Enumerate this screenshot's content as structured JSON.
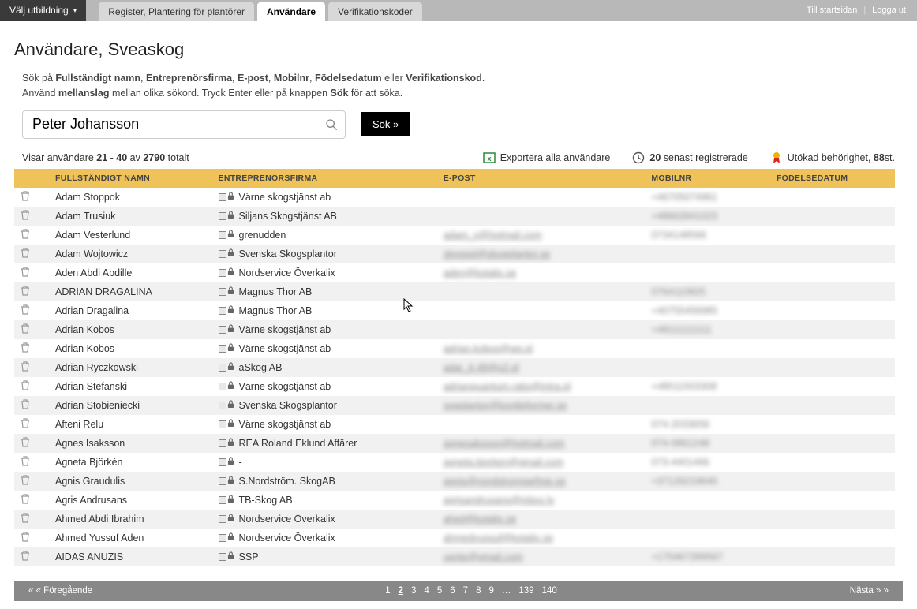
{
  "topbar": {
    "choose": "Välj utbildning",
    "tab1": "Register, Plantering för plantörer",
    "tab2": "Användare",
    "tab3": "Verifikationskoder",
    "start": "Till startsidan",
    "logout": "Logga ut"
  },
  "page": {
    "title": "Användare, Sveaskog",
    "instr1a": "Sök på ",
    "instr1_full": "Fullständigt namn",
    "instr1_sep1": ", ",
    "instr1_firm": "Entreprenörsfirma",
    "instr1_sep2": ", ",
    "instr1_email": "E-post",
    "instr1_sep3": ", ",
    "instr1_mob": "Mobilnr",
    "instr1_sep4": ", ",
    "instr1_dob": "Födelsedatum",
    "instr1_or": " eller ",
    "instr1_ver": "Verifikationskod",
    "instr1_end": ".",
    "instr2a": "Använd ",
    "instr2_space": "mellanslag",
    "instr2b": " mellan olika sökord. Tryck Enter eller på knappen ",
    "instr2_sok": "Sök",
    "instr2c": " för att söka."
  },
  "search": {
    "value": "Peter Johansson",
    "button": "Sök »"
  },
  "meta": {
    "showing_a": "Visar användare ",
    "from": "21",
    "dash": " - ",
    "to": "40",
    "of": " av ",
    "total": "2790",
    "totalt": " totalt",
    "export": "Exportera alla användare",
    "recent_n": "20",
    "recent_t": " senast registrerade",
    "ext_a": "Utökad behörighet, ",
    "ext_n": "88",
    "ext_b": "st."
  },
  "columns": {
    "c1": "FULLSTÄNDIGT NAMN",
    "c2": "ENTREPRENÖRSFIRMA",
    "c3": "E-POST",
    "c4": "MOBILNR",
    "c5": "FÖDELSEDATUM"
  },
  "rows": [
    {
      "name": "Adam Stoppok",
      "firm": "Värne skogstjänst ab",
      "email": "",
      "mobile": "+46705074961"
    },
    {
      "name": "Adam Trusiuk",
      "firm": "Siljans Skogstjänst AB",
      "email": "",
      "mobile": "+48663941023"
    },
    {
      "name": "Adam Vesterlund",
      "firm": "grenudden",
      "email": "adam_v@hotmail.com",
      "mobile": "0734148566"
    },
    {
      "name": "Adam Wojtowicz",
      "firm": "Svenska Skogsplantor",
      "email": "skogspl@skogplantor.se",
      "mobile": ""
    },
    {
      "name": "Aden Abdi Abdille",
      "firm": "Nordservice Överkalix",
      "email": "aden@kotalix.se",
      "mobile": ""
    },
    {
      "name": "ADRIAN DRAGALINA",
      "firm": "Magnus Thor AB",
      "email": "",
      "mobile": "0764110825"
    },
    {
      "name": "Adrian Dragalina",
      "firm": "Magnus Thor AB",
      "email": "",
      "mobile": "+40755456985"
    },
    {
      "name": "Adrian Kobos",
      "firm": "Värne skogstjänst ab",
      "email": "",
      "mobile": "+48111111111"
    },
    {
      "name": "Adrian Kobos",
      "firm": "Värne skogstjänst ab",
      "email": "adrian.kobos@wp.pl",
      "mobile": ""
    },
    {
      "name": "Adrian Ryczkowski",
      "firm": "aSkog AB",
      "email": "adar_6.48@o2.pl",
      "mobile": ""
    },
    {
      "name": "Adrian Stefanski",
      "firm": "Värne skogstjänst ab",
      "email": "adrianquantum.ratio@intra.pl",
      "mobile": "+48511503308"
    },
    {
      "name": "Adrian Stobieniecki",
      "firm": "Svenska Skogsplantor",
      "email": "sogplantor@kontleformer.se",
      "mobile": ""
    },
    {
      "name": "Afteni Relu",
      "firm": "Värne skogstjänst ab",
      "email": "",
      "mobile": "074-2033656"
    },
    {
      "name": "Agnes Isaksson",
      "firm": "REA Roland Eklund Affärer",
      "email": "agnesaksson@hotmail.com",
      "mobile": "074-0861248"
    },
    {
      "name": "Agneta Björkén",
      "firm": "-",
      "email": "agneta.bjorken@gmail.com",
      "mobile": "073-4401466"
    },
    {
      "name": "Agnis Graudulis",
      "firm": "S.Nordström. SkogAB",
      "email": "agnis@nordstromgarfree.se",
      "mobile": "+37126219640"
    },
    {
      "name": "Agris Andrusans",
      "firm": "TB-Skog AB",
      "email": "agrisandrusans@inbox.lv",
      "mobile": ""
    },
    {
      "name": "Ahmed Abdi Ibrahim",
      "firm": "Nordservice Överkalix",
      "email": "ahed@kotalix.se",
      "mobile": ""
    },
    {
      "name": "Ahmed Yussuf Aden",
      "firm": "Nordservice Överkalix",
      "email": "ahmedyussuf@kotalix.se",
      "mobile": ""
    },
    {
      "name": "AIDAS ANUZIS",
      "firm": "SSP",
      "email": "ugrite@gmail.com",
      "mobile": "+170467289567"
    }
  ],
  "pager": {
    "prev": "« « Föregående",
    "next": "Nästa » »",
    "active": "2",
    "pages": [
      "1",
      "2",
      "3",
      "4",
      "5",
      "6",
      "7",
      "8",
      "9",
      "…",
      "139",
      "140"
    ]
  }
}
